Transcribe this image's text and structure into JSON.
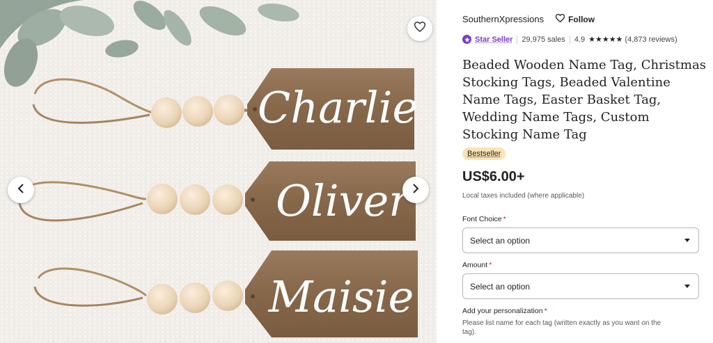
{
  "gallery": {
    "tags": [
      "Charlie",
      "Oliver",
      "Maisie"
    ],
    "favorite_icon": "heart-outline-icon",
    "prev_icon": "chevron-left-icon",
    "next_icon": "chevron-right-icon"
  },
  "shop": {
    "name": "SouthernXpressions",
    "follow_label": "Follow",
    "star_seller_label": "Star Seller",
    "sales": "29,975 sales",
    "rating": "4.9",
    "stars": "★★★★★",
    "reviews": "(4,873 reviews)"
  },
  "listing": {
    "title": "Beaded Wooden Name Tag, Christmas Stocking Tags, Beaded Valentine Name Tags, Easter Basket Tag, Wedding Name Tags, Custom Stocking Name Tag",
    "badge": "Bestseller",
    "price": "US$6.00+",
    "tax_note": "Local taxes included (where applicable)"
  },
  "form": {
    "font_choice_label": "Font Choice",
    "font_choice_value": "Select an option",
    "amount_label": "Amount",
    "amount_value": "Select an option",
    "personalization_label": "Add your personalization",
    "required_mark": "*",
    "personalization_hint": "Please list name for each tag (written exactly as you want on the tag)."
  },
  "colors": {
    "accent_purple": "#7b3cc3",
    "bestseller_bg": "#fbe3b5",
    "required_red": "#b3261e",
    "wood": "#8a6b4e"
  }
}
